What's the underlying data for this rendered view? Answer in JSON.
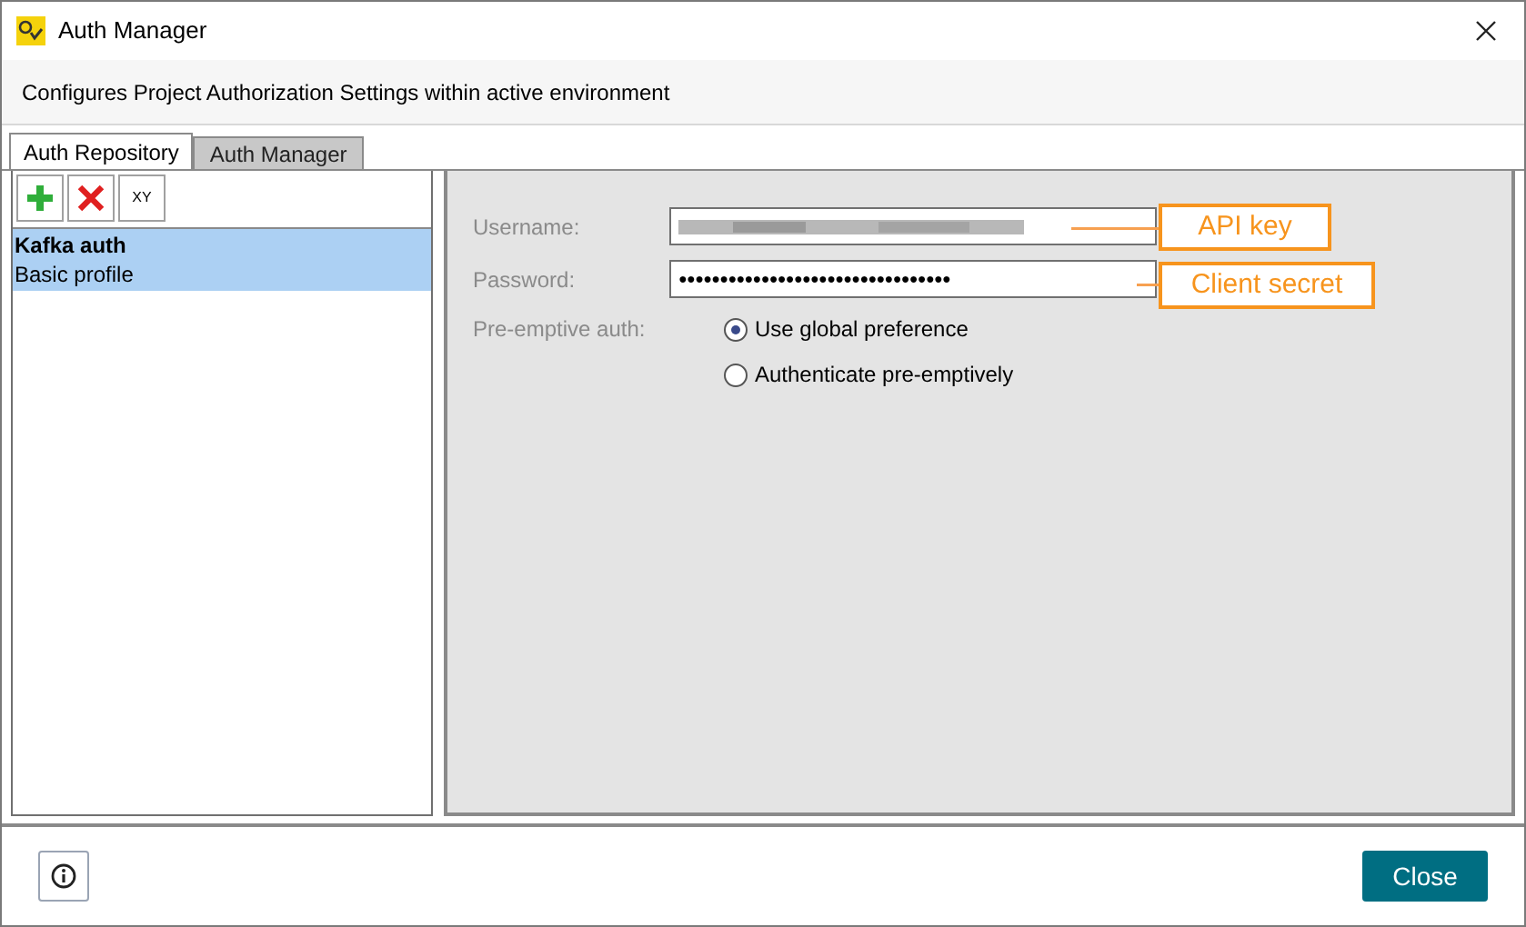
{
  "window": {
    "title": "Auth Manager"
  },
  "description": "Configures Project Authorization Settings within active environment",
  "tabs": [
    {
      "label": "Auth Repository",
      "selected": true
    },
    {
      "label": "Auth Manager",
      "selected": false
    }
  ],
  "toolbar": {
    "buttons": [
      {
        "kind": "add"
      },
      {
        "kind": "delete"
      },
      {
        "kind": "rename",
        "label": "XY"
      }
    ]
  },
  "profiles": [
    {
      "name": "Kafka auth",
      "type": "Basic profile",
      "selected": true
    }
  ],
  "form": {
    "username_label": "Username:",
    "password_label": "Password:",
    "password_value": "●●●●●●●●●●●●●●●●●●●●●●●●●●●●●●●●●",
    "preemptive_label": "Pre-emptive auth:",
    "options": [
      {
        "label": "Use global preference",
        "selected": true
      },
      {
        "label": "Authenticate pre-emptively",
        "selected": false
      }
    ]
  },
  "callouts": [
    {
      "text": "API key"
    },
    {
      "text": "Client secret"
    }
  ],
  "footer": {
    "close": "Close"
  }
}
